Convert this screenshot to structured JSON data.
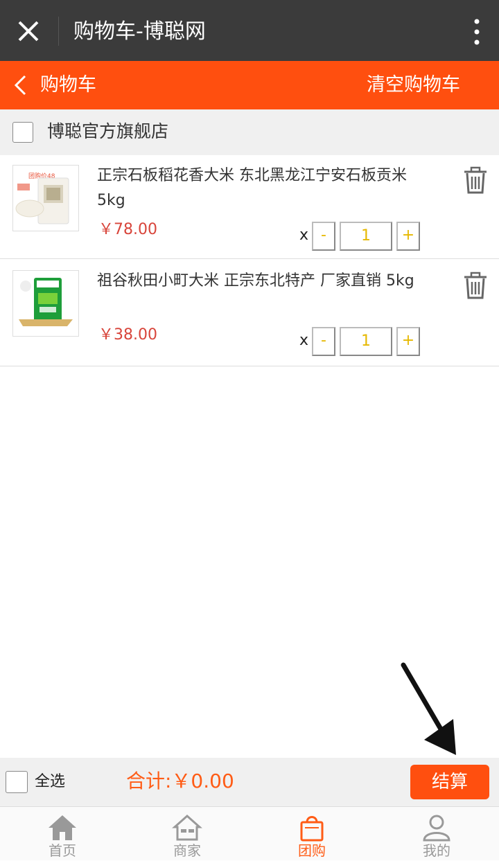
{
  "window": {
    "title": "购物车-博聪网"
  },
  "nav": {
    "title": "购物车",
    "clear_label": "清空购物车"
  },
  "shop": {
    "name": "博聪官方旗舰店"
  },
  "items": [
    {
      "name": "正宗石板稻花香大米 东北黑龙江宁安石板贡米5kg",
      "price": "￥78.00",
      "qty_prefix": "x",
      "minus": "-",
      "qty": "1",
      "plus": "+",
      "thumb_text": "团购价48"
    },
    {
      "name": "祖谷秋田小町大米 正宗东北特产 厂家直销 5kg",
      "price": "￥38.00",
      "qty_prefix": "x",
      "minus": "-",
      "qty": "1",
      "plus": "+"
    }
  ],
  "footer": {
    "select_all": "全选",
    "total": "合计:￥0.00",
    "checkout": "结算"
  },
  "tabs": [
    {
      "label": "首页",
      "icon": "home-icon",
      "active": false
    },
    {
      "label": "商家",
      "icon": "store-icon",
      "active": false
    },
    {
      "label": "团购",
      "icon": "shopping-bag-icon",
      "active": true
    },
    {
      "label": "我的",
      "icon": "user-icon",
      "active": false
    }
  ],
  "colors": {
    "accent": "#ff4f0f",
    "titlebar": "#3b3b3b",
    "price": "#d8453b",
    "qty_text": "#e6b800",
    "total": "#ff5c16"
  }
}
